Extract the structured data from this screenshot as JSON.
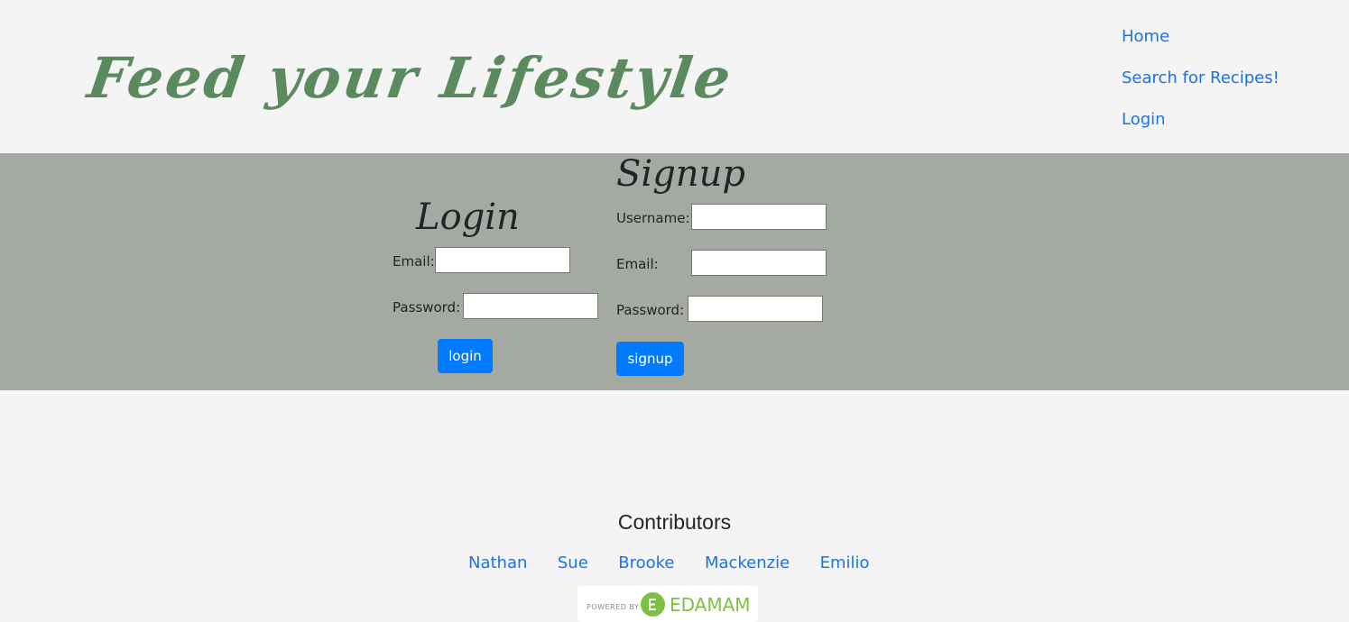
{
  "header": {
    "brand": "Feed your Lifestyle",
    "nav": [
      "Home",
      "Search for Recipes!",
      "Login"
    ]
  },
  "login": {
    "title": "Login",
    "email_label": "Email:",
    "password_label": "Password:",
    "button": "login"
  },
  "signup": {
    "title": "Signup",
    "username_label": "Username:",
    "email_label": "Email:",
    "password_label": "Password:",
    "button": "signup"
  },
  "footer": {
    "title": "Contributors",
    "contributors": [
      "Nathan",
      "Sue",
      "Brooke",
      "Mackenzie",
      "Emilio"
    ],
    "powered_by": "POWERED BY",
    "edamam": "EDAMAM"
  },
  "colors": {
    "brand_green": "#5a8a5e",
    "band_gray": "#a4a9a1",
    "button_blue": "#007bff",
    "link_blue": "#1a73e8",
    "edamam_green": "#7cc242"
  }
}
